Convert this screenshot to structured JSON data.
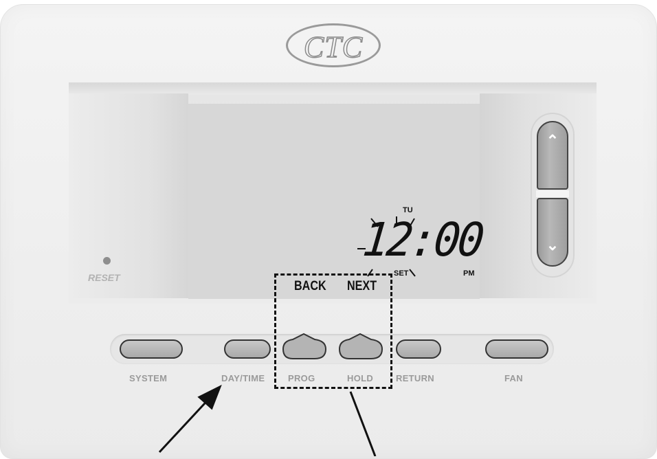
{
  "brand": {
    "logo": "CTC"
  },
  "reset": {
    "label": "RESET"
  },
  "lcd": {
    "day": "TU",
    "time": "12:00",
    "set": "SET",
    "ampm": "PM",
    "soft_keys": {
      "back": "BACK",
      "next": "NEXT"
    }
  },
  "rocker": {
    "up_icon": "chevron-up-icon",
    "down_icon": "chevron-down-icon"
  },
  "buttons": [
    {
      "label": "SYSTEM"
    },
    {
      "label": "DAY/TIME"
    },
    {
      "label": "PROG"
    },
    {
      "label": "HOLD"
    },
    {
      "label": "RETURN"
    },
    {
      "label": "FAN"
    }
  ],
  "colors": {
    "lcd": "#d7d7d7",
    "body": "#eeeeee",
    "button": "#b4b4b4",
    "label": "#9a9a9a"
  }
}
